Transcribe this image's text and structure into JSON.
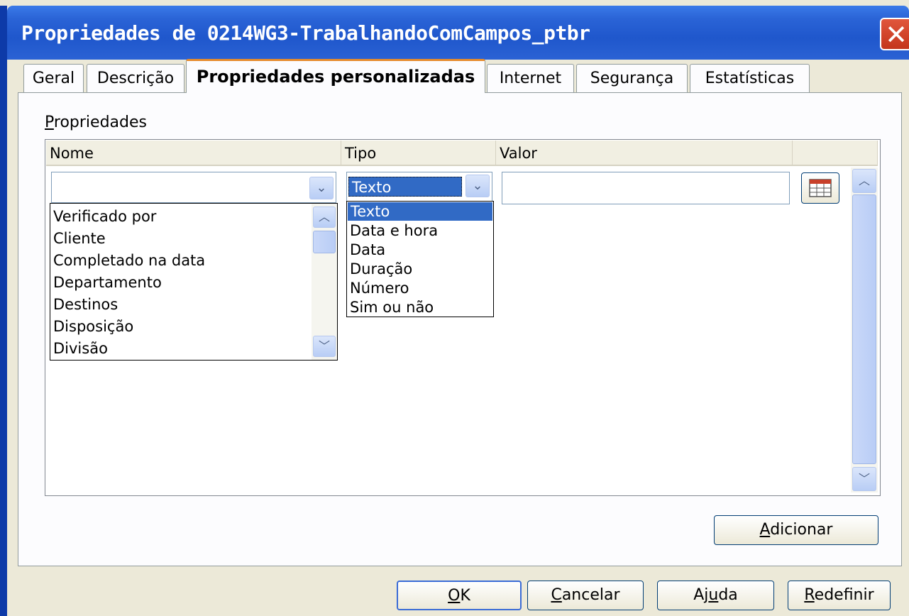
{
  "window": {
    "title": "Propriedades de 0214WG3-TrabalhandoComCampos_ptbr",
    "close_icon": "close-icon"
  },
  "tabs": [
    {
      "label": "Geral",
      "active": false
    },
    {
      "label": "Descrição",
      "active": false
    },
    {
      "label": "Propriedades personalizadas",
      "active": true
    },
    {
      "label": "Internet",
      "active": false
    },
    {
      "label": "Segurança",
      "active": false
    },
    {
      "label": "Estatísticas",
      "active": false
    }
  ],
  "properties": {
    "group_label_first": "P",
    "group_label_rest": "ropriedades",
    "columns": {
      "name": "Nome",
      "type": "Tipo",
      "value": "Valor"
    },
    "name_field": {
      "value": ""
    },
    "name_options": [
      "Verificado por",
      "Cliente",
      "Completado na data",
      "Departamento",
      "Destinos",
      "Disposição",
      "Divisão"
    ],
    "type_field": {
      "value": "Texto"
    },
    "type_options": [
      "Texto",
      "Data e hora",
      "Data",
      "Duração",
      "Número",
      "Sim ou não"
    ],
    "type_selected_index": 0,
    "value_field": {
      "value": ""
    },
    "calendar_icon": "calendar-grid-icon"
  },
  "buttons": {
    "add": {
      "prefix": "",
      "mnemonic": "A",
      "suffix": "dicionar"
    },
    "ok": {
      "prefix": "",
      "mnemonic": "O",
      "suffix": "K"
    },
    "cancel": {
      "prefix": "",
      "mnemonic": "C",
      "suffix": "ancelar"
    },
    "help": {
      "prefix": "Aj",
      "mnemonic": "u",
      "suffix": "da"
    },
    "reset": {
      "prefix": "",
      "mnemonic": "R",
      "suffix": "edefinir"
    }
  }
}
